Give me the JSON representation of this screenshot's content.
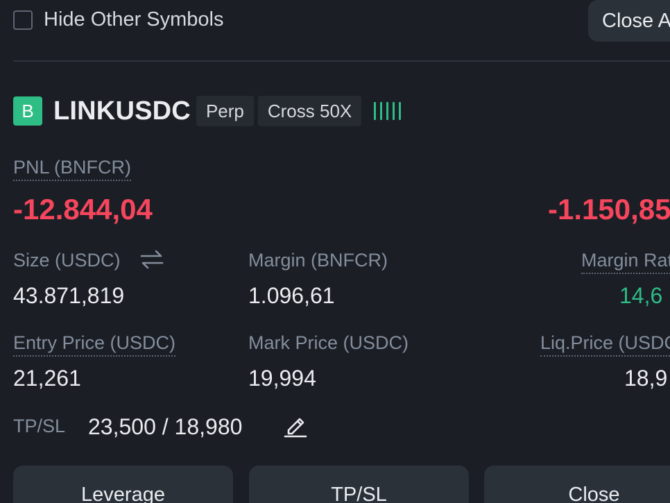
{
  "filter": {
    "hide_other_label": "Hide Other Symbols",
    "close_all_label": "Close All"
  },
  "position": {
    "side_badge": "B",
    "symbol": "LINKUSDC",
    "type_tag": "Perp",
    "leverage_tag": "Cross 50X",
    "pnl_label": "PNL (BNFCR)",
    "pnl_value": "-12.844,04",
    "roi_value": "-1.150,85",
    "size_label": "Size (USDC)",
    "size_value": "43.871,819",
    "margin_label": "Margin (BNFCR)",
    "margin_value": "1.096,61",
    "margin_ratio_label": "Margin Ratio",
    "margin_ratio_value": "14,6",
    "entry_label": "Entry Price (USDC)",
    "entry_value": "21,261",
    "mark_label": "Mark Price (USDC)",
    "mark_value": "19,994",
    "liq_label": "Liq.Price (USDC)",
    "liq_value": "18,9",
    "tpsl_label": "TP/SL",
    "tpsl_value": "23,500 / 18,980"
  },
  "actions": {
    "leverage": "Leverage",
    "tpsl": "TP/SL",
    "close": "Close"
  },
  "colors": {
    "loss": "#f6465d",
    "profit": "#2ebd85",
    "buy_badge": "#2ebd85",
    "background": "#1b1e25"
  },
  "icons": {
    "swap": "swap-arrows-icon",
    "edit": "edit-pencil-icon",
    "adl": "adl-indicator-icon"
  }
}
